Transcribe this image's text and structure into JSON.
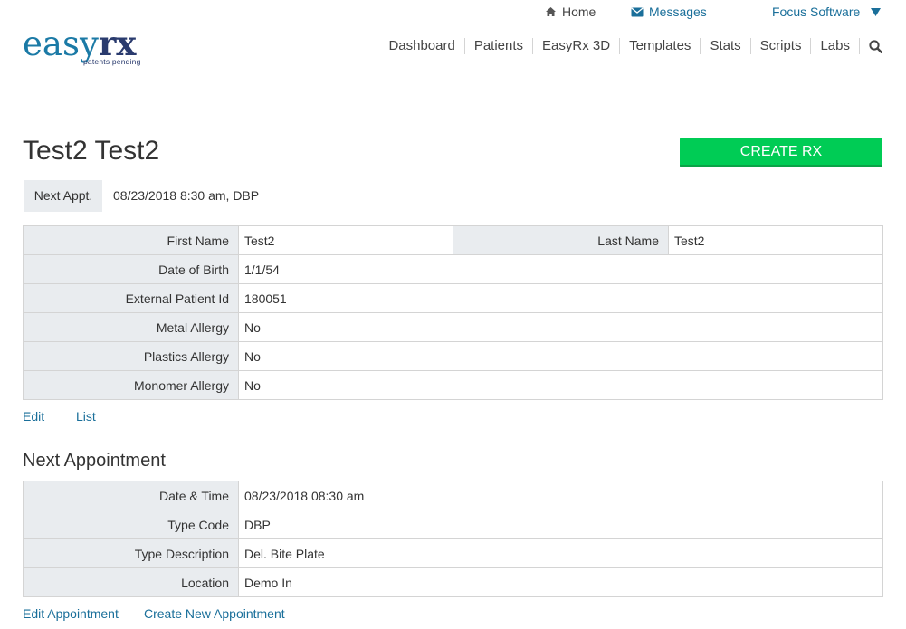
{
  "top_links": {
    "home": "Home",
    "messages": "Messages",
    "account": "Focus Software"
  },
  "logo": {
    "easy": "easy",
    "rx": "rx",
    "tagline": "patents pending"
  },
  "nav": [
    "Dashboard",
    "Patients",
    "EasyRx 3D",
    "Templates",
    "Stats",
    "Scripts",
    "Labs"
  ],
  "patient": {
    "name": "Test2 Test2",
    "create_rx_label": "CREATE RX",
    "next_appt_label": "Next Appt.",
    "next_appt_value": "08/23/2018 8:30 am, DBP",
    "fields": {
      "first_name_label": "First Name",
      "first_name": "Test2",
      "last_name_label": "Last Name",
      "last_name": "Test2",
      "dob_label": "Date of Birth",
      "dob": "1/1/54",
      "external_id_label": "External Patient Id",
      "external_id": "180051",
      "metal_allergy_label": "Metal Allergy",
      "metal_allergy": "No",
      "plastics_allergy_label": "Plastics Allergy",
      "plastics_allergy": "No",
      "monomer_allergy_label": "Monomer Allergy",
      "monomer_allergy": "No"
    },
    "edit_link": "Edit",
    "list_link": "List"
  },
  "appointment": {
    "section_title": "Next Appointment",
    "datetime_label": "Date & Time",
    "datetime": "08/23/2018 08:30 am",
    "type_code_label": "Type Code",
    "type_code": "DBP",
    "type_desc_label": "Type Description",
    "type_desc": "Del. Bite Plate",
    "location_label": "Location",
    "location": "Demo In",
    "edit_link": "Edit Appointment",
    "create_link": "Create New Appointment"
  },
  "colors": {
    "brand_blue": "#1b7aa6",
    "create_green": "#00cc55",
    "label_bg": "#e9ecef"
  }
}
